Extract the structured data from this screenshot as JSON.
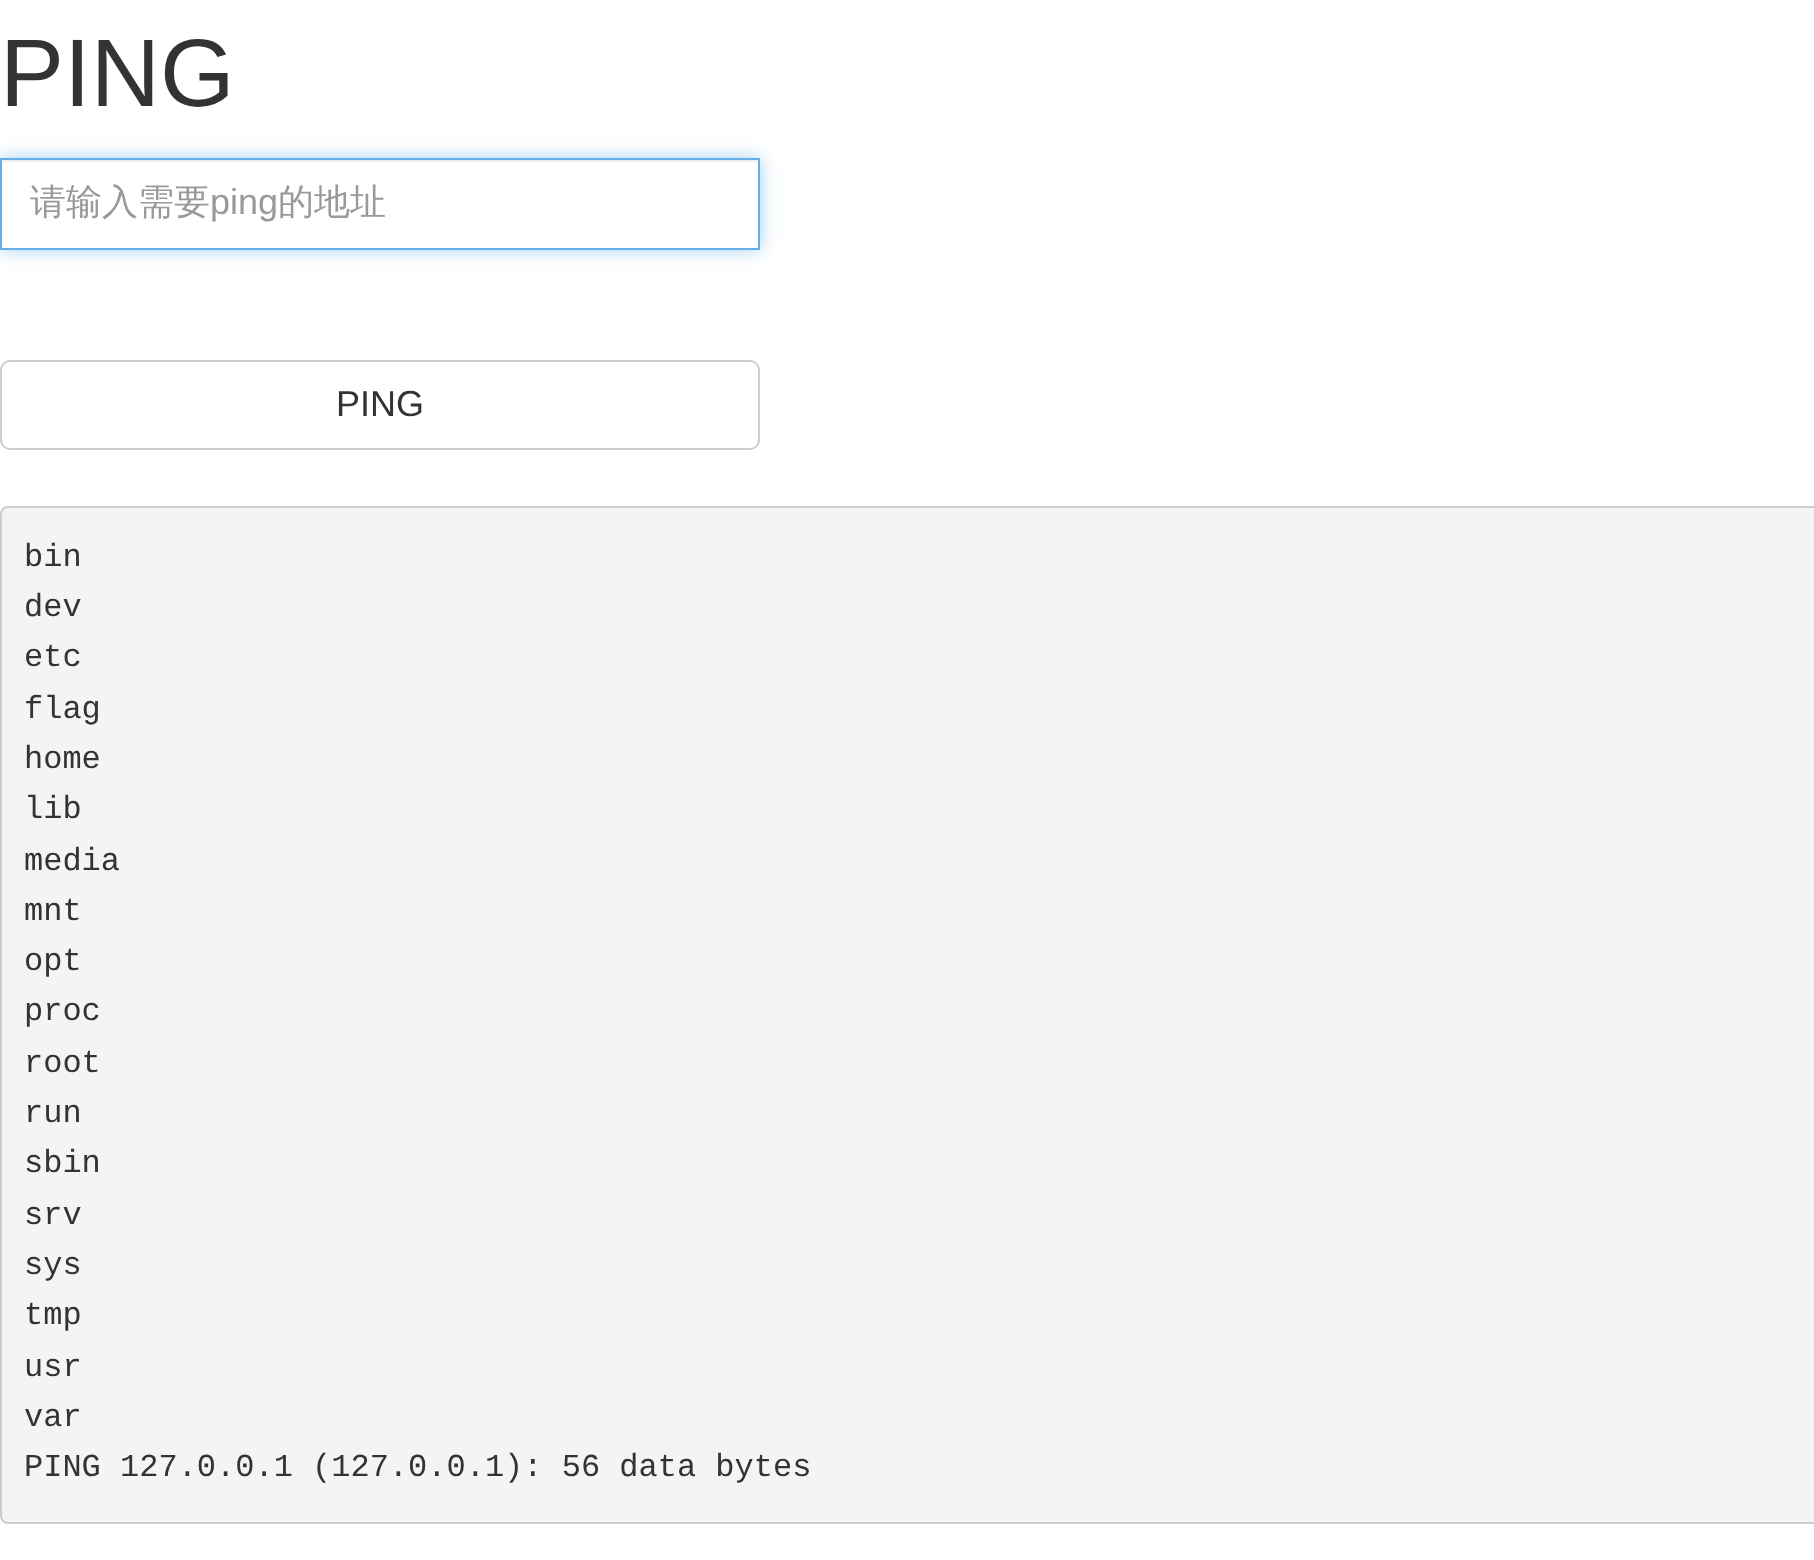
{
  "title": "PING",
  "address_field": {
    "placeholder": "请输入需要ping的地址",
    "focused": true
  },
  "submit_button": {
    "label": "PING"
  },
  "output": {
    "lines": [
      "bin",
      "dev",
      "etc",
      "flag",
      "home",
      "lib",
      "media",
      "mnt",
      "opt",
      "proc",
      "root",
      "run",
      "sbin",
      "srv",
      "sys",
      "tmp",
      "usr",
      "var",
      "PING 127.0.0.1 (127.0.0.1): 56 data bytes"
    ]
  }
}
